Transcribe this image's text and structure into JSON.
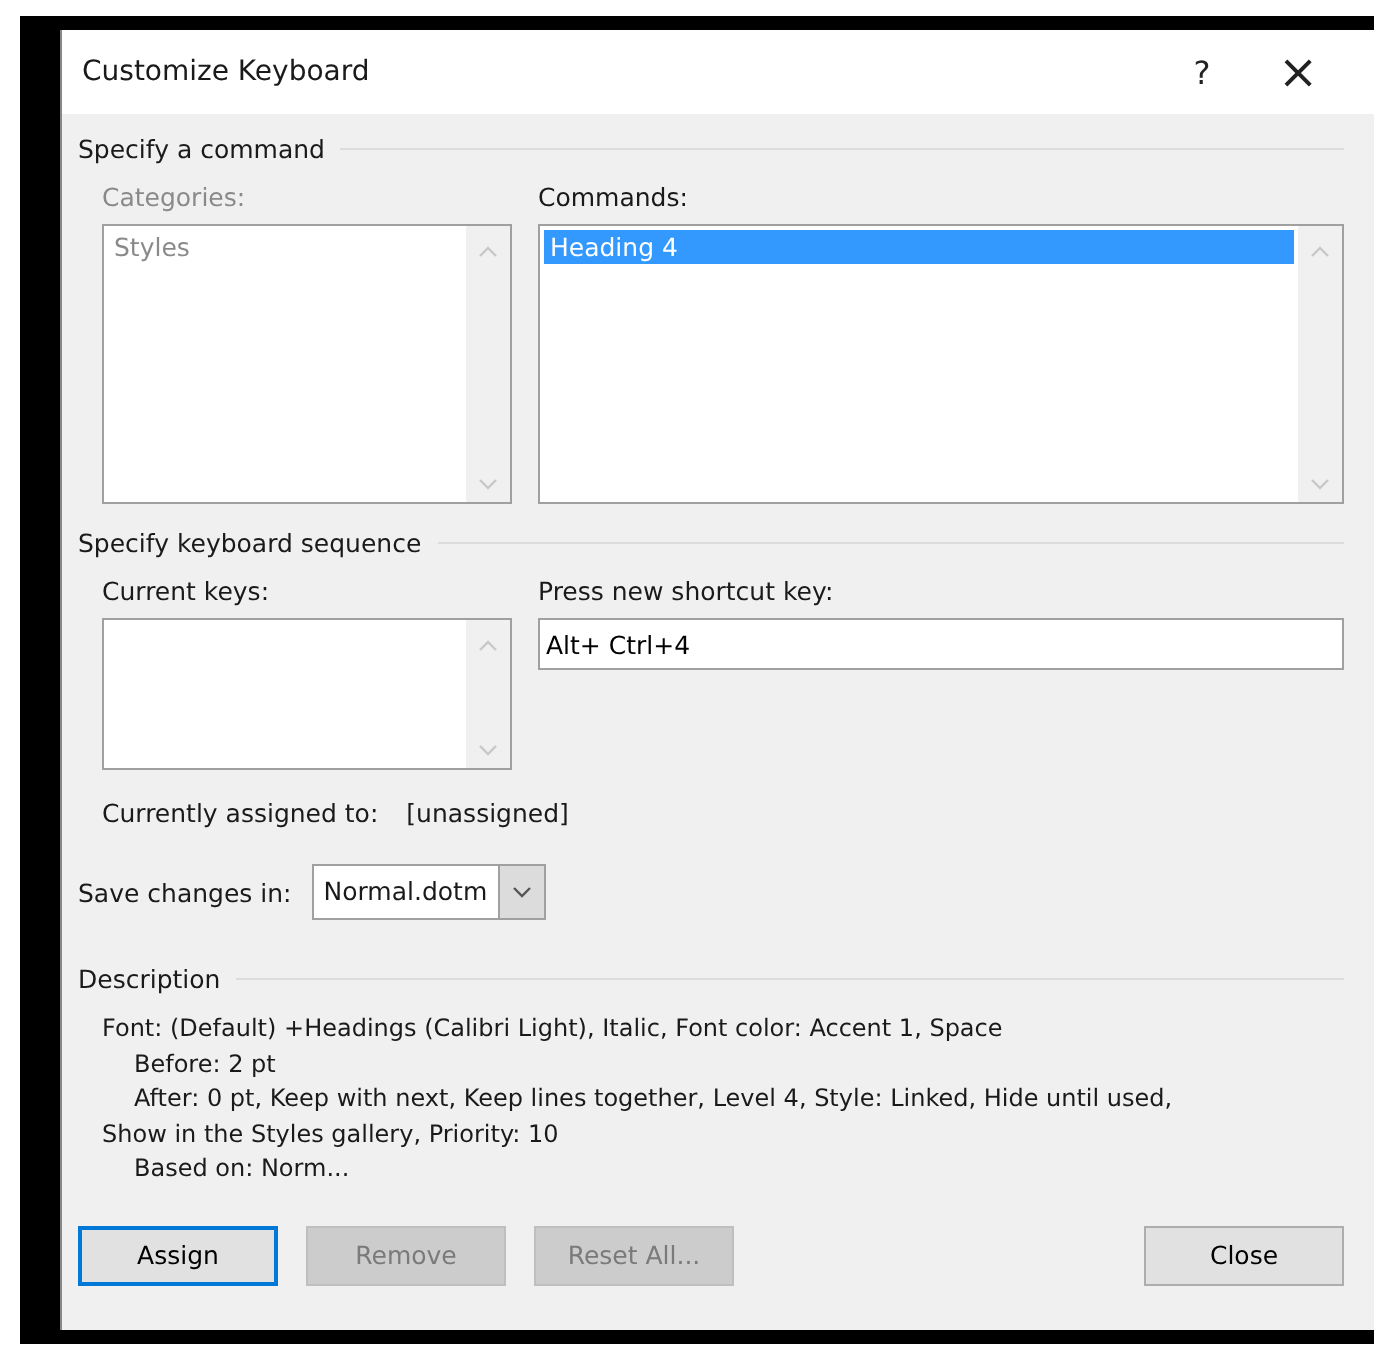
{
  "window": {
    "title": "Customize Keyboard",
    "help_label": "?",
    "close_label": "×"
  },
  "command_section": {
    "title": "Specify a command",
    "categories": {
      "label": "Categories:",
      "disabled": true,
      "items": [
        {
          "label": "Styles",
          "selected": false
        }
      ]
    },
    "commands": {
      "label": "Commands:",
      "disabled": false,
      "items": [
        {
          "label": "Heading 4",
          "selected": true
        }
      ]
    }
  },
  "keyboard_section": {
    "title": "Specify keyboard sequence",
    "current_keys": {
      "label": "Current keys:"
    },
    "new_shortcut": {
      "label": "Press new shortcut key:",
      "value": "Alt+ Ctrl+4"
    },
    "assigned_label": "Currently assigned to:",
    "assigned_value": "[unassigned]"
  },
  "save_in": {
    "label": "Save changes in:",
    "value": "Normal.dotm"
  },
  "description": {
    "title": "Description",
    "lines": [
      {
        "kind": "plain",
        "text": "Font: (Default) +Headings (Calibri Light), Italic, Font color: Accent 1, Space"
      },
      {
        "kind": "indented",
        "text": "Before:  2 pt"
      },
      {
        "kind": "indented",
        "text": "After:  0 pt, Keep with next, Keep lines together, Level 4, Style: Linked, Hide until used,"
      },
      {
        "kind": "plain",
        "text": "Show in the Styles gallery, Priority: 10"
      },
      {
        "kind": "indented",
        "text": "Based on: Norm..."
      }
    ]
  },
  "buttons": [
    {
      "label": "Assign",
      "disabled": false,
      "default": true
    },
    {
      "label": "Remove",
      "disabled": true,
      "default": false
    },
    {
      "label": "Reset All...",
      "disabled": true,
      "default": false
    },
    {
      "label": "Close",
      "disabled": false,
      "default": false
    }
  ]
}
